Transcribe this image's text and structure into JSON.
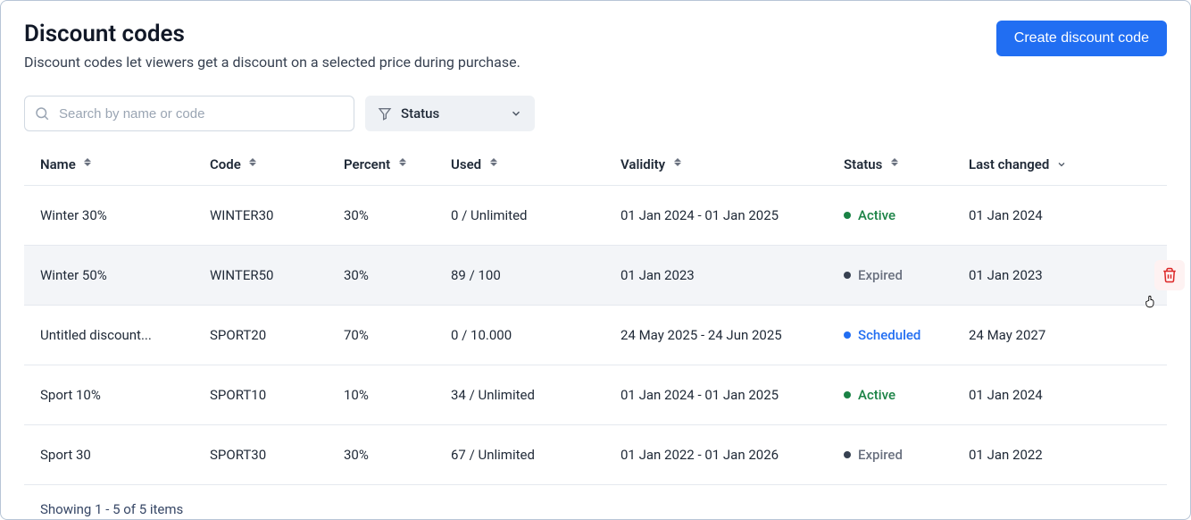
{
  "header": {
    "title": "Discount codes",
    "subtitle": "Discount codes let viewers get a discount on a selected price during purchase.",
    "create_button": "Create discount code"
  },
  "filters": {
    "search_placeholder": "Search by name or code",
    "status_label": "Status"
  },
  "columns": {
    "name": "Name",
    "code": "Code",
    "percent": "Percent",
    "used": "Used",
    "validity": "Validity",
    "status": "Status",
    "last_changed": "Last changed"
  },
  "rows": [
    {
      "name": "Winter 30%",
      "code": "WINTER30",
      "percent": "30%",
      "used": "0 / Unlimited",
      "validity": "01 Jan 2024 - 01 Jan 2025",
      "status": "Active",
      "last_changed": "01 Jan 2024",
      "hovered": false
    },
    {
      "name": "Winter 50%",
      "code": "WINTER50",
      "percent": "30%",
      "used": "89 / 100",
      "validity": "01 Jan 2023",
      "status": "Expired",
      "last_changed": "01 Jan 2023",
      "hovered": true
    },
    {
      "name": "Untitled discount...",
      "code": "SPORT20",
      "percent": "70%",
      "used": "0 / 10.000",
      "validity": "24 May 2025 - 24 Jun 2025",
      "status": "Scheduled",
      "last_changed": "24 May 2027",
      "hovered": false
    },
    {
      "name": "Sport 10%",
      "code": "SPORT10",
      "percent": "10%",
      "used": "34 / Unlimited",
      "validity": "01 Jan 2024 - 01 Jan 2025",
      "status": "Active",
      "last_changed": "01 Jan 2024",
      "hovered": false
    },
    {
      "name": "Sport 30",
      "code": "SPORT30",
      "percent": "30%",
      "used": "67 / Unlimited",
      "validity": "01 Jan 2022 - 01 Jan 2026",
      "status": "Expired",
      "last_changed": "01 Jan 2022",
      "hovered": false
    }
  ],
  "footer": {
    "showing": "Showing 1 - 5 of 5 items"
  }
}
